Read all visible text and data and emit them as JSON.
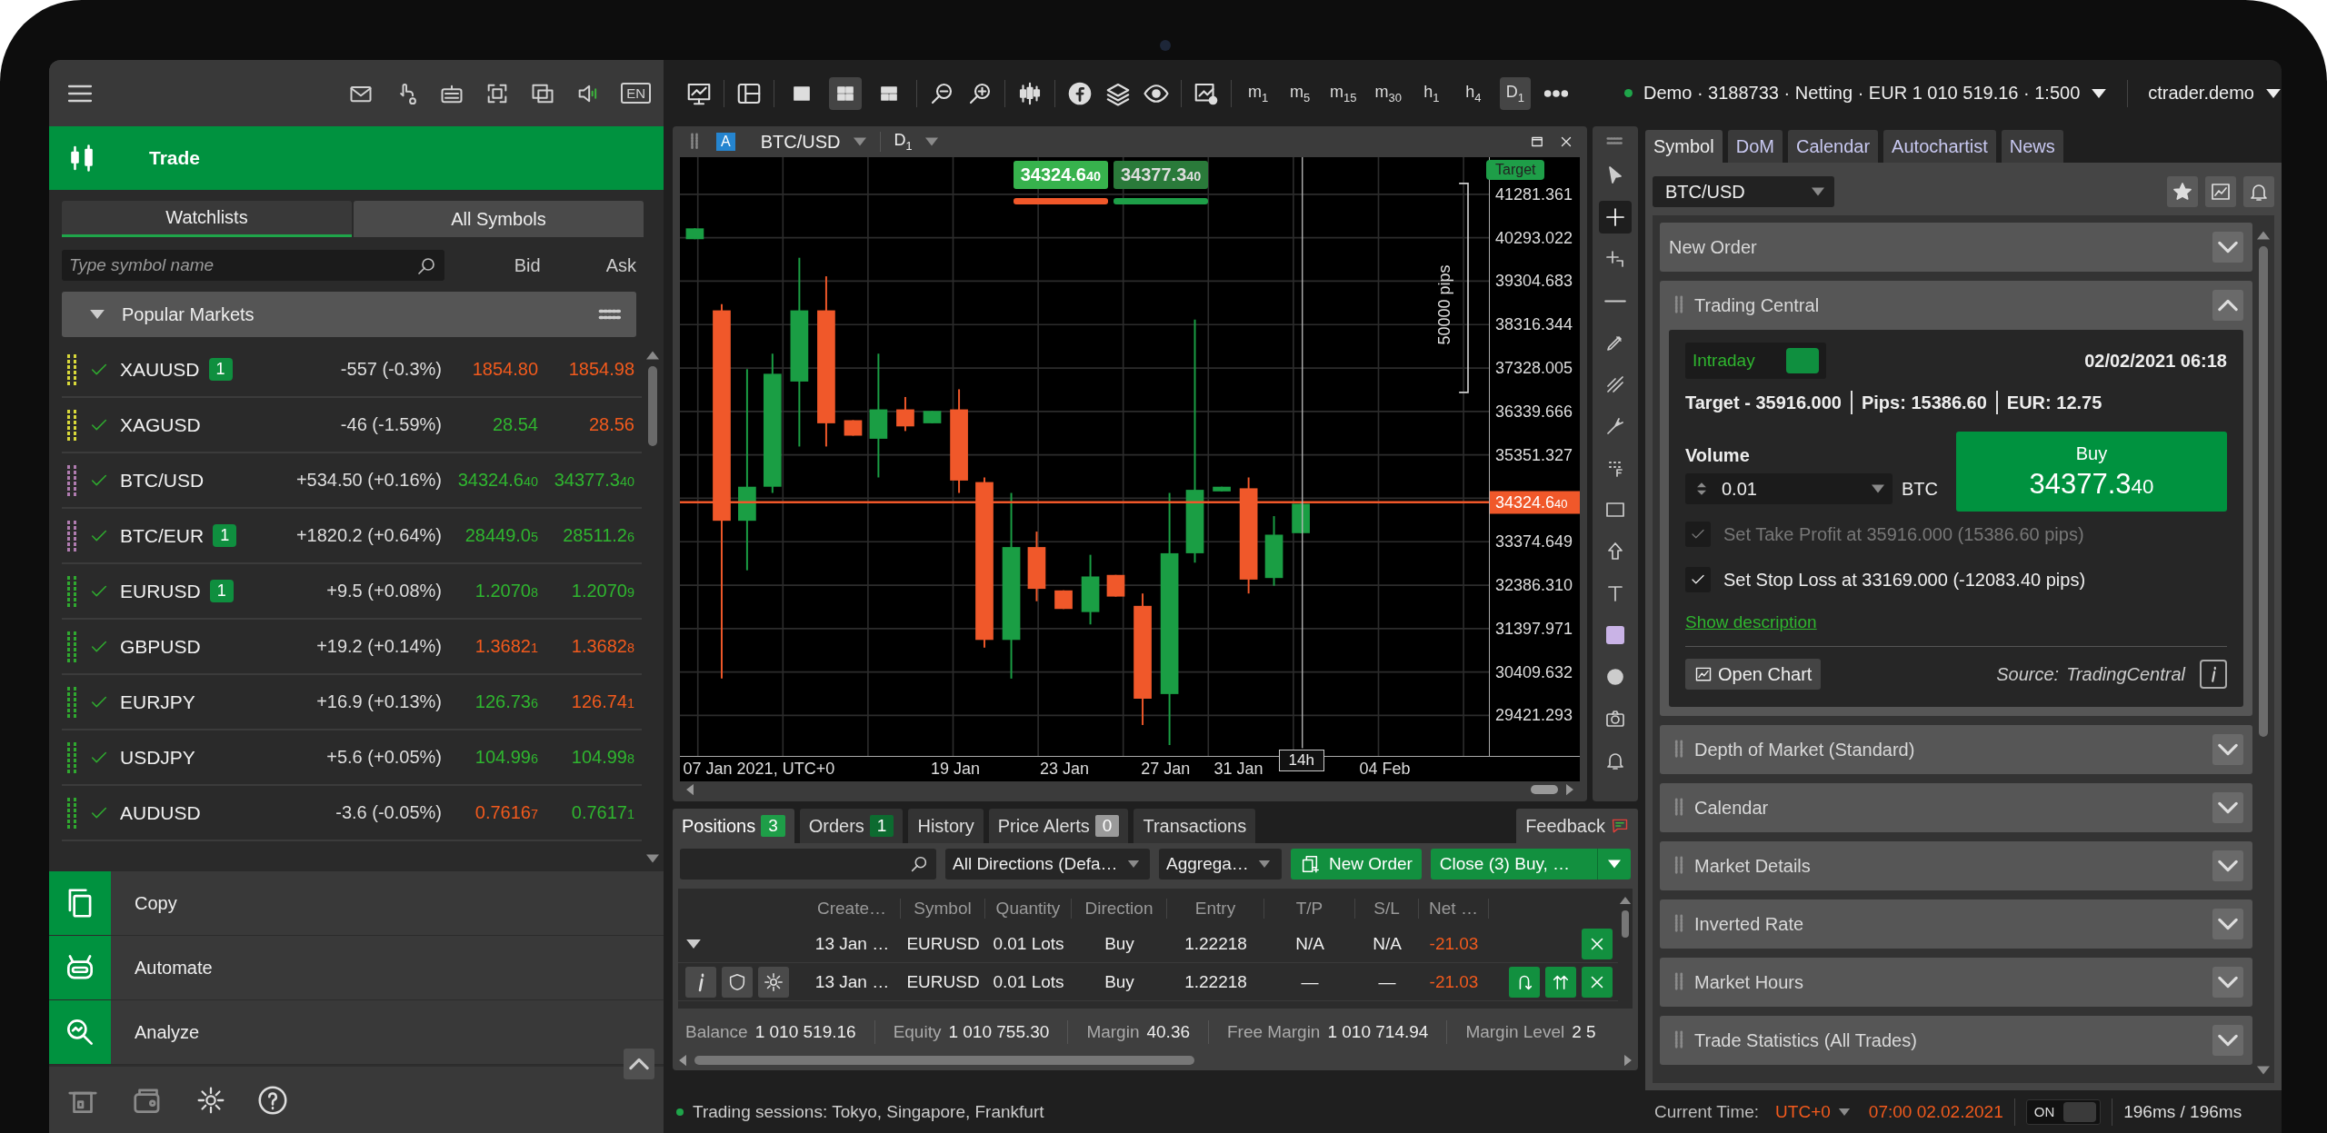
{
  "left_panel": {
    "language": "EN",
    "section": "Trade",
    "tabs": [
      {
        "label": "Watchlists",
        "selected": true
      },
      {
        "label": "All Symbols",
        "selected": false
      }
    ],
    "search": {
      "placeholder": "Type symbol name"
    },
    "columns": [
      "Bid",
      "Ask"
    ],
    "group": {
      "title": "Popular Markets",
      "expanded": true
    },
    "rows": [
      {
        "symbol": "XAUUSD",
        "color": "#d8d83a",
        "badge": "1",
        "change": "-557 (-0.3%)",
        "bid": "1854.80",
        "bid_up": false,
        "ask": "1854.98",
        "ask_up": false
      },
      {
        "symbol": "XAGUSD",
        "color": "#d8d83a",
        "change": "-46 (-1.59%)",
        "bid": "28.54",
        "bid_up": true,
        "ask": "28.56",
        "ask_up": false
      },
      {
        "symbol": "BTC/USD",
        "color": "#b07cb0",
        "change": "+534.50 (+0.16%)",
        "bid": "34324.6$_{40}$",
        "bid_up": true,
        "ask": "34377.3$_{40}$",
        "ask_up": true
      },
      {
        "symbol": "BTC/EUR",
        "color": "#b07cb0",
        "badge": "1",
        "change": "+1820.2 (+0.64%)",
        "bid": "28449.0$_{5}$",
        "bid_up": true,
        "ask": "28511.2$_{6}$",
        "ask_up": true
      },
      {
        "symbol": "EURUSD",
        "color": "#2fa82f",
        "badge": "1",
        "change": "+9.5 (+0.08%)",
        "bid": "1.2070$_{8}$",
        "bid_up": true,
        "ask": "1.2070$_{9}$",
        "ask_up": true
      },
      {
        "symbol": "GBPUSD",
        "color": "#2fa82f",
        "change": "+19.2 (+0.14%)",
        "bid": "1.3682$_{1}$",
        "bid_up": false,
        "ask": "1.3682$_{8}$",
        "ask_up": false
      },
      {
        "symbol": "EURJPY",
        "color": "#2fa82f",
        "change": "+16.9 (+0.13%)",
        "bid": "126.73$_{6}$",
        "bid_up": true,
        "ask": "126.74$_{1}$",
        "ask_up": false
      },
      {
        "symbol": "USDJPY",
        "color": "#2fa82f",
        "change": "+5.6 (+0.05%)",
        "bid": "104.99$_{6}$",
        "bid_up": true,
        "ask": "104.99$_{8}$",
        "ask_up": true
      },
      {
        "symbol": "AUDUSD",
        "color": "#2fa82f",
        "change": "-3.6 (-0.05%)",
        "bid": "0.7616$_{7}$",
        "bid_up": false,
        "ask": "0.7617$_{1}$",
        "ask_up": true
      }
    ],
    "nav": [
      "Copy",
      "Automate",
      "Analyze"
    ]
  },
  "toolbar": {
    "layouts": [
      {
        "selected": false
      },
      {
        "selected": true
      },
      {
        "selected": false
      }
    ],
    "timeframes": [
      {
        "label": "m$_{1}$",
        "selected": false
      },
      {
        "label": "m$_{5}$",
        "selected": false
      },
      {
        "label": "m$_{15}$",
        "selected": false
      },
      {
        "label": "m$_{30}$",
        "selected": false
      },
      {
        "label": "h$_{1}$",
        "selected": false
      },
      {
        "label": "h$_{4}$",
        "selected": false
      },
      {
        "label": "D$_{1}$",
        "selected": true
      }
    ]
  },
  "account": {
    "summary": "Demo · 3188733 · Netting · EUR 1 010 519.16 · 1:500",
    "user": "ctrader.demo"
  },
  "chart": {
    "badge": "A",
    "symbol": "BTC/USD",
    "timeframe": "D$_{1}$",
    "bid_button": "34324.6$_{40}$",
    "ask_button": "34377.3$_{40}$",
    "target_tag": "Target",
    "range_label": "50000 pips",
    "price_scale": [
      "41281.361",
      "40293.022",
      "39304.683",
      "38316.344",
      "37328.005",
      "36339.666",
      "35351.327",
      "33374.649",
      "32386.310",
      "31397.971",
      "30409.632",
      "29421.293"
    ],
    "current_price": "34324.6$_{40}$",
    "time_scale": [
      "07 Jan 2021, UTC+0",
      "19 Jan",
      "23 Jan",
      "27 Jan",
      "31 Jan",
      "04 Feb"
    ],
    "crosshair_time": "14h"
  },
  "drawing_tools": [
    {
      "selected": false
    },
    {
      "selected": true
    },
    {
      "selected": false
    },
    {
      "selected": false
    },
    {
      "selected": false
    },
    {
      "selected": false
    },
    {
      "selected": false
    },
    {
      "selected": false
    },
    {
      "selected": false
    },
    {
      "selected": false
    },
    {
      "selected": false
    },
    {
      "selected": false
    },
    {
      "selected": false
    },
    {
      "selected": false
    },
    {
      "selected": false
    }
  ],
  "positions_panel": {
    "tabs": [
      {
        "label": "Positions",
        "count": "3",
        "badge_muted": false,
        "selected": true
      },
      {
        "label": "Orders",
        "count": "1",
        "badge_muted": false,
        "selected": false
      },
      {
        "label": "History",
        "selected": false
      },
      {
        "label": "Price Alerts",
        "count": "0",
        "badge_muted": true,
        "selected": false
      },
      {
        "label": "Transactions",
        "selected": false
      }
    ],
    "feedback": "Feedback",
    "direction_filter": "All Directions (Defa…",
    "grouping_filter": "Aggrega…",
    "new_order": "New Order",
    "close_all": "Close (3) Buy, …",
    "columns": [
      "Create…",
      "Symbol",
      "Quantity",
      "Direction",
      "Entry",
      "T/P",
      "S/L",
      "Net …"
    ],
    "rows": [
      {
        "kind": "group",
        "expanded": true,
        "cells": [
          "13 Jan …",
          "EURUSD",
          "0.01 Lots",
          "Buy",
          "1.22218",
          "N/A",
          "N/A",
          "-21.03"
        ]
      },
      {
        "kind": "position",
        "cells": [
          "13 Jan …",
          "EURUSD",
          "0.01 Lots",
          "Buy",
          "1.22218",
          "—",
          "—",
          "-21.03"
        ]
      }
    ],
    "summary": [
      {
        "label": "Balance",
        "value": "1 010 519.16"
      },
      {
        "label": "Equity",
        "value": "1 010 755.30"
      },
      {
        "label": "Margin",
        "value": "40.36"
      },
      {
        "label": "Free Margin",
        "value": "1 010 714.94"
      },
      {
        "label": "Margin Level",
        "value": "2 5"
      }
    ]
  },
  "right_panel": {
    "tabs": [
      {
        "label": "Symbol",
        "selected": true
      },
      {
        "label": "DoM",
        "selected": false
      },
      {
        "label": "Calendar",
        "selected": false
      },
      {
        "label": "Autochartist",
        "selected": false
      },
      {
        "label": "News",
        "selected": false
      }
    ],
    "symbol": "BTC/USD",
    "sections": [
      {
        "title": "New Order",
        "expanded": false,
        "draggable": false
      },
      {
        "title": "Trading Central",
        "expanded": true,
        "draggable": true
      },
      {
        "title": "Depth of Market (Standard)",
        "expanded": false,
        "draggable": true
      },
      {
        "title": "Calendar",
        "expanded": false,
        "draggable": true
      },
      {
        "title": "Market Details",
        "expanded": false,
        "draggable": true
      },
      {
        "title": "Inverted Rate",
        "expanded": false,
        "draggable": true
      },
      {
        "title": "Market Hours",
        "expanded": false,
        "draggable": true
      },
      {
        "title": "Trade Statistics (All Trades)",
        "expanded": false,
        "draggable": true
      }
    ],
    "trading_central": {
      "mode": "Intraday",
      "mode_on": true,
      "timestamp": "02/02/2021 06:18",
      "stats": [
        "Target - 35916.000",
        "Pips: 15386.60",
        "EUR: 12.75"
      ],
      "volume_label": "Volume",
      "volume": "0.01",
      "unit": "BTC",
      "buy_label": "Buy",
      "buy_price": "34377.3$_{40}$",
      "options": [
        {
          "label": "Set Take Profit at 35916.000 (15386.60 pips)",
          "checked": true,
          "disabled": true
        },
        {
          "label": "Set Stop Loss at 33169.000 (-12083.40 pips)",
          "checked": true,
          "disabled": false
        }
      ],
      "link": "Show description",
      "open_chart": "Open Chart",
      "source_label": "Source:",
      "source": "TradingCentral"
    }
  },
  "status_bar": {
    "sessions": "Trading sessions: Tokyo, Singapore, Frankfurt",
    "time_label": "Current Time:",
    "timezone": "UTC+0",
    "time": "07:00 02.02.2021",
    "toggle_label": "ON",
    "toggle_on": true,
    "latency": "196ms / 196ms"
  }
}
